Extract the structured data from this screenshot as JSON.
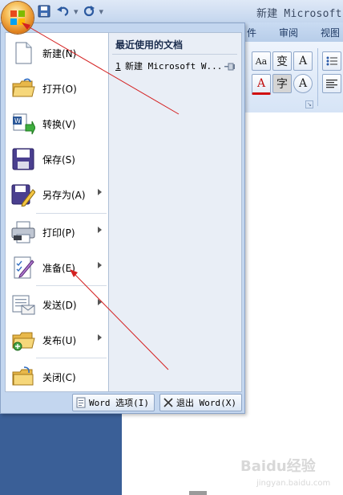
{
  "window": {
    "doc_title": "新建 Microsoft W"
  },
  "quick_access": {
    "icons": [
      "save-icon",
      "undo-icon",
      "redo-icon",
      "customize-dropdown-icon"
    ]
  },
  "ribbon": {
    "tabs": [
      "件",
      "审阅",
      "视图"
    ],
    "buttons": [
      "Aa",
      "变",
      "A",
      "A",
      "字",
      "A"
    ]
  },
  "menu": {
    "items": [
      {
        "label": "新建(N)",
        "icon": "new-document-icon",
        "submenu": false
      },
      {
        "label": "打开(O)",
        "icon": "open-folder-icon",
        "submenu": false
      },
      {
        "label": "转换(V)",
        "icon": "convert-icon",
        "submenu": false
      },
      {
        "label": "保存(S)",
        "icon": "save-icon",
        "submenu": false
      },
      {
        "label": "另存为(A)",
        "icon": "save-as-icon",
        "submenu": true
      },
      {
        "label": "打印(P)",
        "icon": "printer-icon",
        "submenu": true
      },
      {
        "label": "准备(E)",
        "icon": "prepare-icon",
        "submenu": true
      },
      {
        "label": "发送(D)",
        "icon": "send-icon",
        "submenu": true
      },
      {
        "label": "发布(U)",
        "icon": "publish-icon",
        "submenu": true
      },
      {
        "label": "关闭(C)",
        "icon": "close-folder-icon",
        "submenu": false
      }
    ],
    "recent_heading": "最近使用的文档",
    "recent_documents": [
      {
        "number": "1",
        "name": "新建 Microsoft W..."
      }
    ],
    "footer": {
      "options_label": "Word 选项(I)",
      "exit_label": "退出 Word(X)"
    }
  },
  "watermark": {
    "text": "Baidu经验",
    "sub": "jingyan.baidu.com"
  },
  "colors": {
    "menu_frame": "#c3d6ef",
    "annotation_arrow": "#d42020",
    "ribbon_blue": "#dfe9f7"
  }
}
